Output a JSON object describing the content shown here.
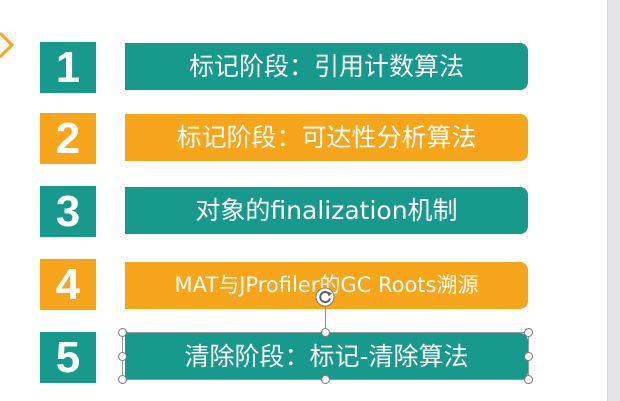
{
  "slide": {
    "items": [
      {
        "number": "1",
        "label": "标记阶段：引用计数算法",
        "color": "#179a8c"
      },
      {
        "number": "2",
        "label": "标记阶段：可达性分析算法",
        "color": "#f7a51b"
      },
      {
        "number": "3",
        "label": "对象的finalization机制",
        "color": "#179a8c"
      },
      {
        "number": "4",
        "label": "MAT与JProfiler的GC Roots溯源",
        "color": "#f7a51b"
      },
      {
        "number": "5",
        "label": "清除阶段：标记-清除算法",
        "color": "#179a8c"
      }
    ]
  },
  "selection": {
    "selected_item": "5",
    "icons": [
      "rotate-handle-icon",
      "resize-handle-icon"
    ]
  },
  "colors": {
    "teal": "#179a8c",
    "orange": "#f7a51b",
    "background": "#ffffff"
  }
}
